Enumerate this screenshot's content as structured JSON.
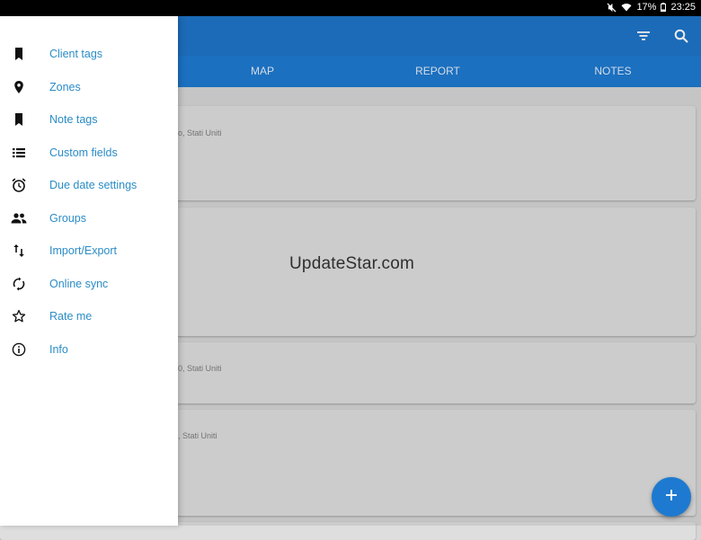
{
  "status_bar": {
    "battery": "17%",
    "time": "23:25"
  },
  "app_bar": {
    "filter_icon": "filter-icon",
    "search_icon": "search-icon"
  },
  "tabs": [
    {
      "label": "MAP"
    },
    {
      "label": "REPORT"
    },
    {
      "label": "NOTES"
    }
  ],
  "cards": [
    {
      "text": "o, Stati Uniti"
    },
    {
      "text": ""
    },
    {
      "text": "0, Stati Uniti"
    },
    {
      "text": ", Stati Uniti"
    }
  ],
  "watermark": "UpdateStar.com",
  "drawer": {
    "items": [
      {
        "label": "Client tags",
        "icon": "bookmark-icon"
      },
      {
        "label": "Zones",
        "icon": "location-pin-icon"
      },
      {
        "label": "Note tags",
        "icon": "bookmark-icon"
      },
      {
        "label": "Custom fields",
        "icon": "list-icon"
      },
      {
        "label": "Due date settings",
        "icon": "alarm-clock-icon"
      },
      {
        "label": "Groups",
        "icon": "group-icon"
      },
      {
        "label": "Import/Export",
        "icon": "import-export-icon"
      },
      {
        "label": "Online sync",
        "icon": "sync-icon"
      },
      {
        "label": "Rate me",
        "icon": "star-icon"
      },
      {
        "label": "Info",
        "icon": "info-icon"
      }
    ]
  },
  "fab": {
    "icon": "add-icon"
  },
  "colors": {
    "primary": "#1e75c8",
    "accent_text": "#2a8cc6"
  }
}
